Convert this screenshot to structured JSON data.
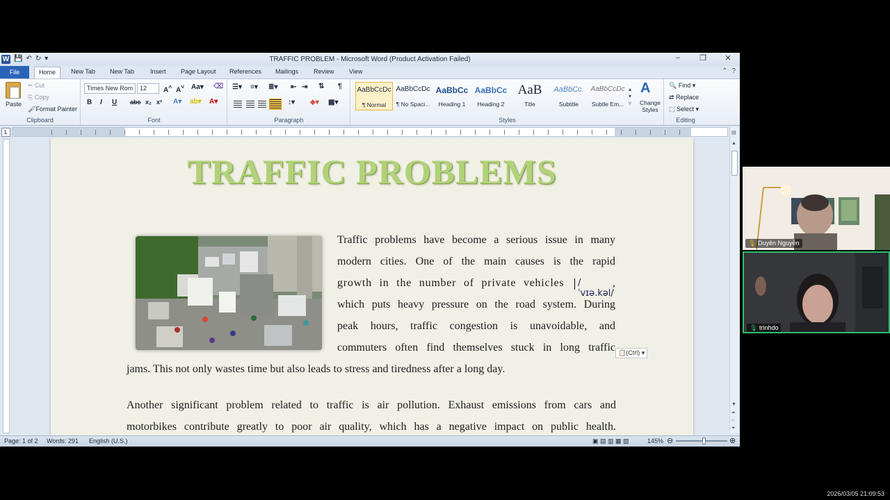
{
  "window": {
    "title": "TRAFFIC PROBLEM  -  Microsoft Word (Product Activation Failed)",
    "app_icon": "W"
  },
  "tabs": [
    "File",
    "Home",
    "New Tab",
    "New Tab",
    "Insert",
    "Page Layout",
    "References",
    "Mailings",
    "Review",
    "View"
  ],
  "ribbon": {
    "clipboard": {
      "paste": "Paste",
      "cut": "Cut",
      "copy": "Copy",
      "format_painter": "Format Painter",
      "label": "Clipboard"
    },
    "font": {
      "face": "Times New Rom",
      "size": "12",
      "label": "Font"
    },
    "paragraph": {
      "label": "Paragraph"
    },
    "styles": {
      "items": [
        {
          "sample": "AaBbCcDc",
          "name": "¶ Normal"
        },
        {
          "sample": "AaBbCcDc",
          "name": "¶ No Spaci..."
        },
        {
          "sample": "AaBbCc",
          "name": "Heading 1"
        },
        {
          "sample": "AaBbCc",
          "name": "Heading 2"
        },
        {
          "sample": "AaB",
          "name": "Title"
        },
        {
          "sample": "AaBbCc.",
          "name": "Subtitle"
        },
        {
          "sample": "AaBbCcDc",
          "name": "Subtle Em..."
        }
      ],
      "change_styles": "Change Styles",
      "label": "Styles"
    },
    "editing": {
      "find": "Find",
      "replace": "Replace",
      "select": "Select",
      "label": "Editing"
    }
  },
  "document": {
    "title": "TRAFFIC PROBLEMS",
    "para1_lines": [
      "Traffic problems have become a serious issue in many",
      "modern cities. One of the main causes is the rapid",
      "growth in the number of private vehicles",
      "which puts heavy pressure on the road system. During",
      "peak hours, traffic congestion is unavoidable, and",
      "commuters often find themselves stuck in long traffic"
    ],
    "para1_last": "jams. This not only wastes time but also leads to stress and tiredness after a long day.",
    "phonetic": "/ˈvɪə.kəl/",
    "para2_lines": [
      "Another significant problem related to traffic is air pollution. Exhaust emissions from cars and",
      "motorbikes contribute greatly to poor air quality, which has a negative impact on public health."
    ],
    "paste_tag": "(Ctrl)"
  },
  "status": {
    "page": "Page: 1 of 2",
    "words": "Words: 291",
    "language": "English (U.S.)",
    "zoom": "145%"
  },
  "participants": [
    "Duyên Nguyễn",
    "trinhdo"
  ],
  "timestamp": "2026/03/05 21:09:53"
}
